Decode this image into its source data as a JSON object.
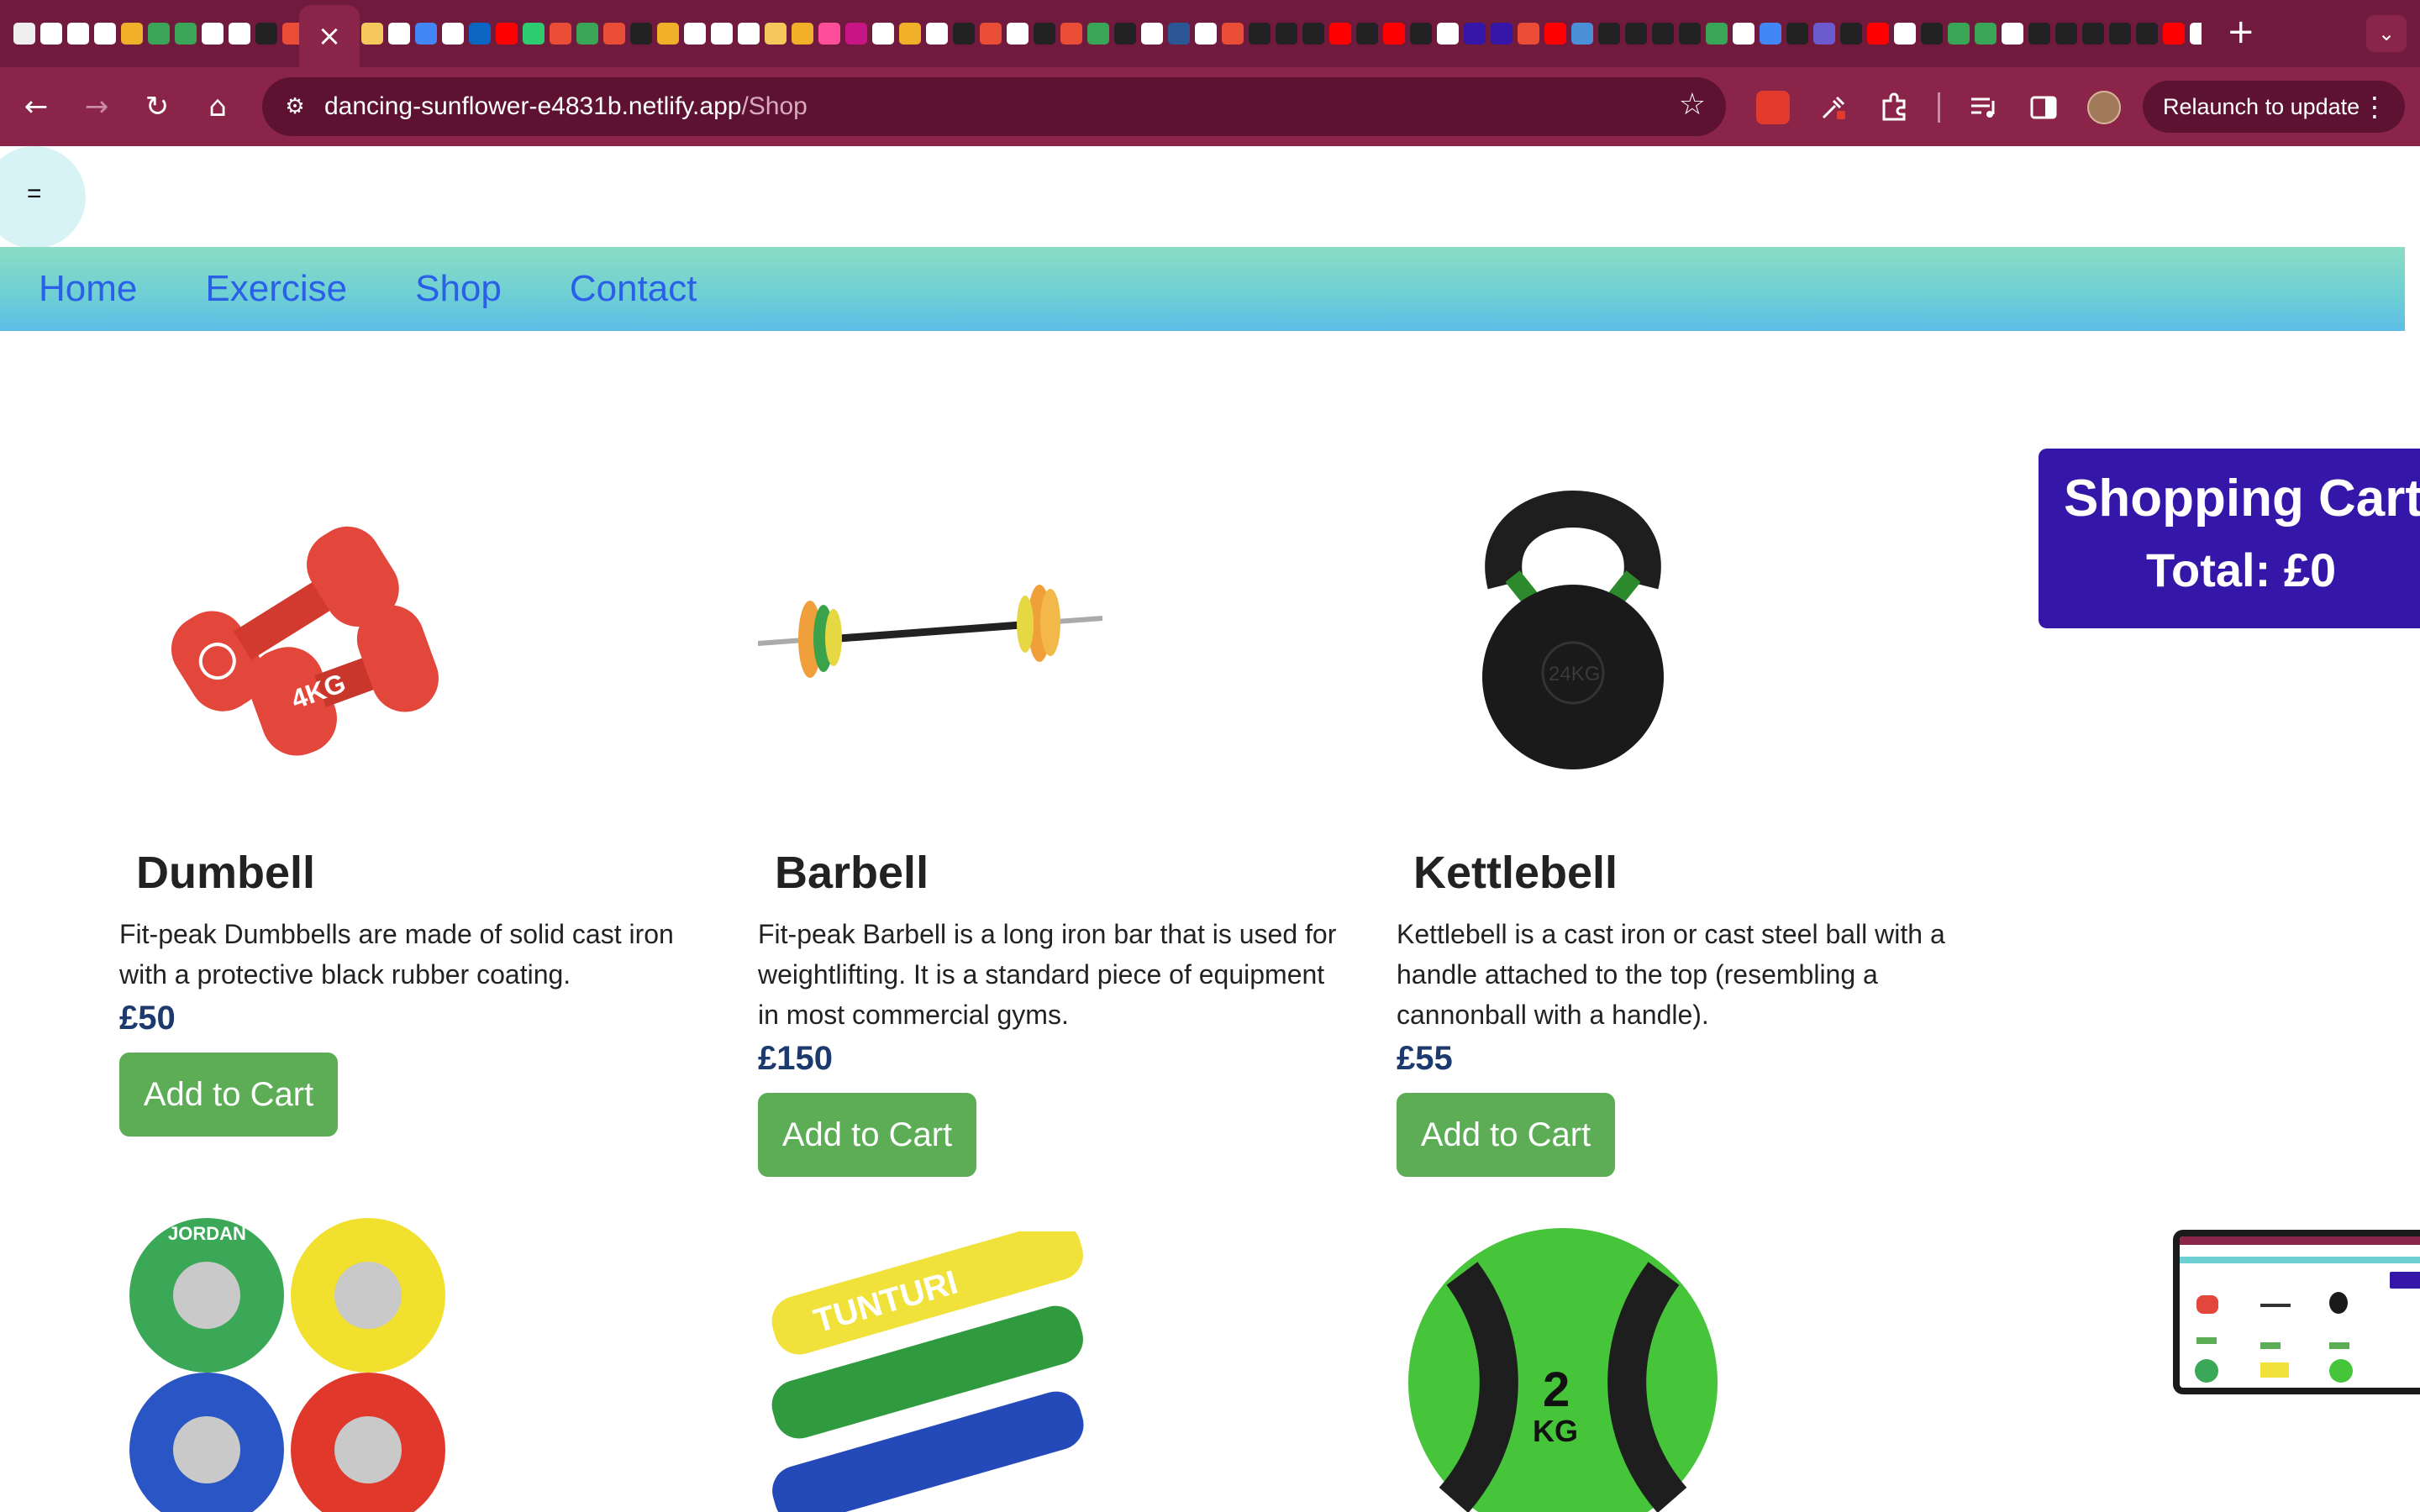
{
  "browser": {
    "active_tab_close": "×",
    "new_tab": "+",
    "tab_search": "⌄",
    "url_host": "dancing-sunflower-e4831b.netlify.app",
    "url_path": "/Shop",
    "relaunch_label": "Relaunch to update",
    "back": "←",
    "forward": "→",
    "reload": "↻",
    "home": "⌂",
    "star": "☆",
    "menu": "⋮",
    "site_info": "⚙"
  },
  "page": {
    "menu_toggle": "=",
    "nav": [
      "Home",
      "Exercise",
      "Shop",
      "Contact"
    ],
    "cart": {
      "title": "Shopping Cart",
      "total": "Total: £0"
    },
    "products": [
      {
        "name": "Dumbell",
        "description": "Fit-peak Dumbbells are made of solid cast iron with a protective black rubber coating.",
        "price": "£50",
        "button": "Add to Cart"
      },
      {
        "name": "Barbell",
        "description": "Fit-peak Barbell is a long iron bar that is used for weightlifting. It is a standard piece of equipment in most commercial gyms.",
        "price": "£150",
        "button": "Add to Cart"
      },
      {
        "name": "Kettlebell",
        "description": "Kettlebell is a cast iron or cast steel ball with a handle attached to the top (resembling a cannonball with a handle).",
        "price": "£55",
        "button": "Add to Cart"
      }
    ],
    "row2_labels": {
      "plates_brand": "JORDAN",
      "bands_brand": "TUNTURI",
      "ball_weight": "2",
      "ball_unit": "KG"
    },
    "image_labels": {
      "dumbbell_weight": "4KG",
      "kettlebell_weight": "24KG"
    }
  },
  "colors": {
    "tabstrip": "#701a3e",
    "toolbar": "#8a2449",
    "cart_bg": "#3416a8",
    "button_green": "#5cad55",
    "nav_link": "#2a5fe8",
    "price": "#1d3a6e"
  }
}
